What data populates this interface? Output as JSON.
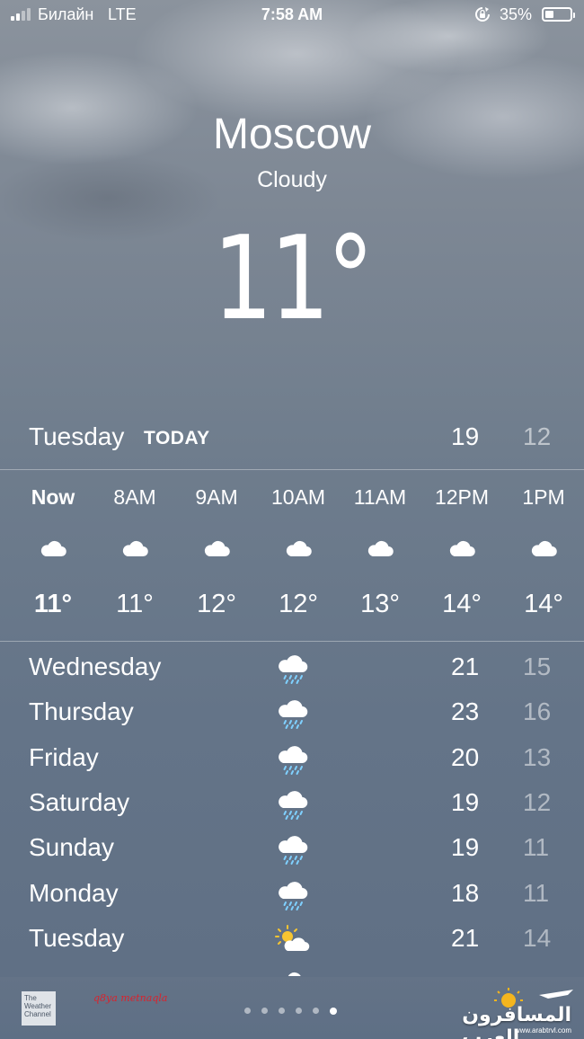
{
  "status_bar": {
    "carrier": "Билайн",
    "network": "LTE",
    "time": "7:58 AM",
    "battery": "35%",
    "battery_level": 0.35
  },
  "header": {
    "city": "Moscow",
    "condition": "Cloudy",
    "temperature": "11°"
  },
  "today": {
    "day": "Tuesday",
    "tag": "TODAY",
    "high": "19",
    "low": "12"
  },
  "hourly": [
    {
      "time": "Now",
      "icon": "cloud-icon",
      "temp": "11°"
    },
    {
      "time": "8AM",
      "icon": "cloud-icon",
      "temp": "11°"
    },
    {
      "time": "9AM",
      "icon": "cloud-icon",
      "temp": "12°"
    },
    {
      "time": "10AM",
      "icon": "cloud-icon",
      "temp": "12°"
    },
    {
      "time": "11AM",
      "icon": "cloud-icon",
      "temp": "13°"
    },
    {
      "time": "12PM",
      "icon": "cloud-icon",
      "temp": "14°"
    },
    {
      "time": "1PM",
      "icon": "cloud-icon",
      "temp": "14°"
    }
  ],
  "daily": [
    {
      "day": "Wednesday",
      "icon": "rain-cloud-icon",
      "high": "21",
      "low": "15"
    },
    {
      "day": "Thursday",
      "icon": "rain-cloud-icon",
      "high": "23",
      "low": "16"
    },
    {
      "day": "Friday",
      "icon": "rain-cloud-icon",
      "high": "20",
      "low": "13"
    },
    {
      "day": "Saturday",
      "icon": "rain-cloud-icon",
      "high": "19",
      "low": "12"
    },
    {
      "day": "Sunday",
      "icon": "rain-cloud-icon",
      "high": "19",
      "low": "11"
    },
    {
      "day": "Monday",
      "icon": "rain-cloud-icon",
      "high": "18",
      "low": "11"
    },
    {
      "day": "Tuesday",
      "icon": "partly-sunny-icon",
      "high": "21",
      "low": "14"
    }
  ],
  "bottom_bar": {
    "logo_text": "The Weather Channel",
    "watermark": "q8ya metnaqla",
    "page_count": 6,
    "active_page": 6,
    "site_name": "المسافرون العرب",
    "site_url": "www.arabtrvl.com"
  }
}
